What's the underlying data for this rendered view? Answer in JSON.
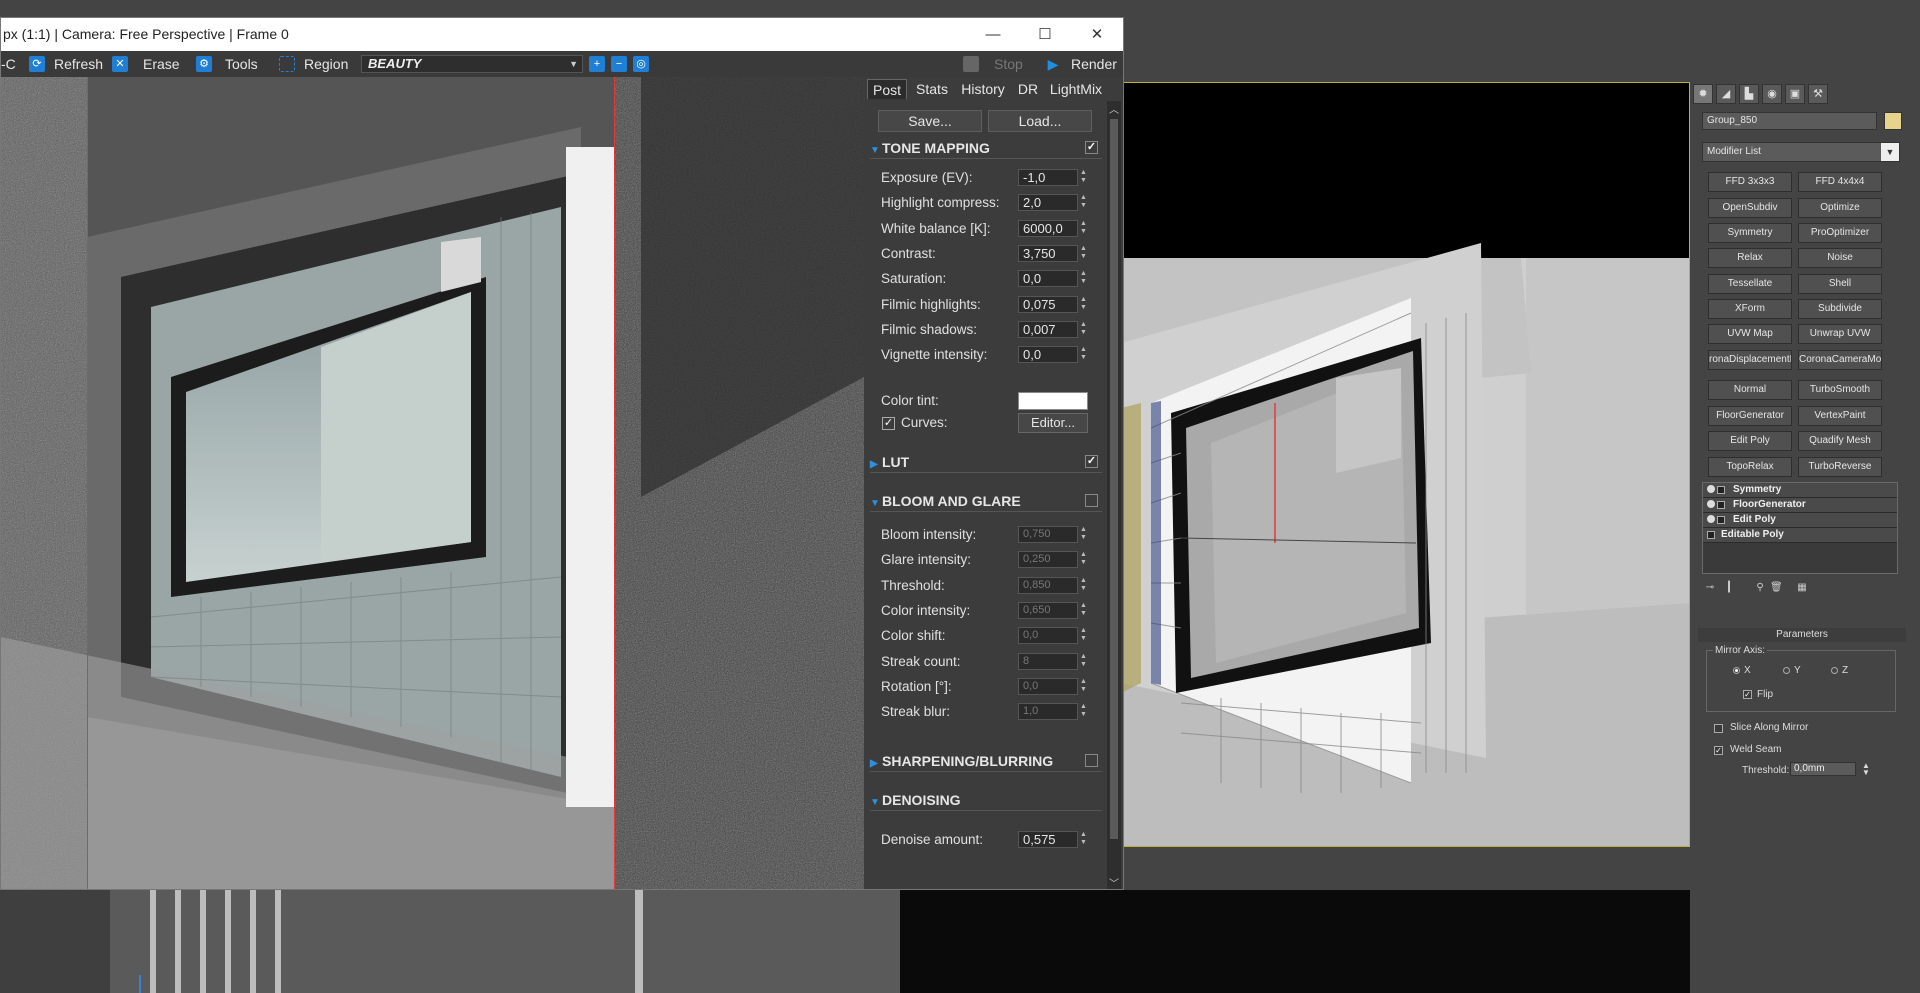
{
  "vfb": {
    "title": "px (1:1) | Camera: Free Perspective | Frame 0",
    "controls": {
      "minimize": "—",
      "maximize": "☐",
      "close": "✕"
    },
    "toolbar": {
      "prefix": "-C",
      "refresh": "Refresh",
      "erase": "Erase",
      "tools": "Tools",
      "region": "Region",
      "channel": "BEAUTY",
      "stop": "Stop",
      "render": "Render"
    }
  },
  "side_panel": {
    "tabs": [
      "Post",
      "Stats",
      "History",
      "DR",
      "LightMix"
    ],
    "active_tab": "Post",
    "save_label": "Save...",
    "load_label": "Load...",
    "tone_mapping": {
      "title": "TONE MAPPING",
      "enabled": true,
      "rows": [
        {
          "label": "Exposure (EV):",
          "value": "-1,0"
        },
        {
          "label": "Highlight compress:",
          "value": "2,0"
        },
        {
          "label": "White balance [K]:",
          "value": "6000,0"
        },
        {
          "label": "Contrast:",
          "value": "3,750"
        },
        {
          "label": "Saturation:",
          "value": "0,0"
        },
        {
          "label": "Filmic highlights:",
          "value": "0,075"
        },
        {
          "label": "Filmic shadows:",
          "value": "0,007"
        },
        {
          "label": "Vignette intensity:",
          "value": "0,0"
        }
      ],
      "color_tint_label": "Color tint:",
      "color_tint": "#ffffff",
      "curves_label": "Curves:",
      "curves_enabled": true,
      "editor_label": "Editor..."
    },
    "lut": {
      "title": "LUT",
      "enabled": true
    },
    "bloom_glare": {
      "title": "BLOOM AND GLARE",
      "enabled": false,
      "rows": [
        {
          "label": "Bloom intensity:",
          "value": "0,750"
        },
        {
          "label": "Glare intensity:",
          "value": "0,250"
        },
        {
          "label": "Threshold:",
          "value": "0,850"
        },
        {
          "label": "Color intensity:",
          "value": "0,650"
        },
        {
          "label": "Color shift:",
          "value": "0,0"
        },
        {
          "label": "Streak count:",
          "value": "8"
        },
        {
          "label": "Rotation [°]:",
          "value": "0,0"
        },
        {
          "label": "Streak blur:",
          "value": "1,0"
        }
      ]
    },
    "sharpening": {
      "title": "SHARPENING/BLURRING",
      "enabled": false
    },
    "denoising": {
      "title": "DENOISING",
      "rows": [
        {
          "label": "Denoise amount:",
          "value": "0,575"
        }
      ]
    }
  },
  "command_panel": {
    "object_name": "Group_850",
    "object_color": "#e7d48c",
    "modifier_list": "Modifier List",
    "modifier_buttons": [
      "FFD 3x3x3",
      "FFD 4x4x4",
      "OpenSubdiv",
      "Optimize",
      "Symmetry",
      "ProOptimizer",
      "Relax",
      "Noise",
      "Tessellate",
      "Shell",
      "XForm",
      "Subdivide",
      "UVW Map",
      "Unwrap UVW",
      "ronaDisplacementM",
      "CoronaCameraMod",
      "Normal",
      "TurboSmooth",
      "FloorGenerator",
      "VertexPaint",
      "Edit Poly",
      "Quadify Mesh",
      "TopoRelax",
      "TurboReverse"
    ],
    "stack": [
      "Symmetry",
      "FloorGenerator",
      "Edit Poly",
      "Editable Poly"
    ],
    "parameters_title": "Parameters",
    "mirror_axis_label": "Mirror Axis:",
    "axes": [
      "X",
      "Y",
      "Z"
    ],
    "selected_axis": "X",
    "flip_label": "Flip",
    "slice_label": "Slice Along Mirror",
    "weld_label": "Weld Seam",
    "threshold_label": "Threshold:",
    "threshold_value": "0,0mm"
  }
}
